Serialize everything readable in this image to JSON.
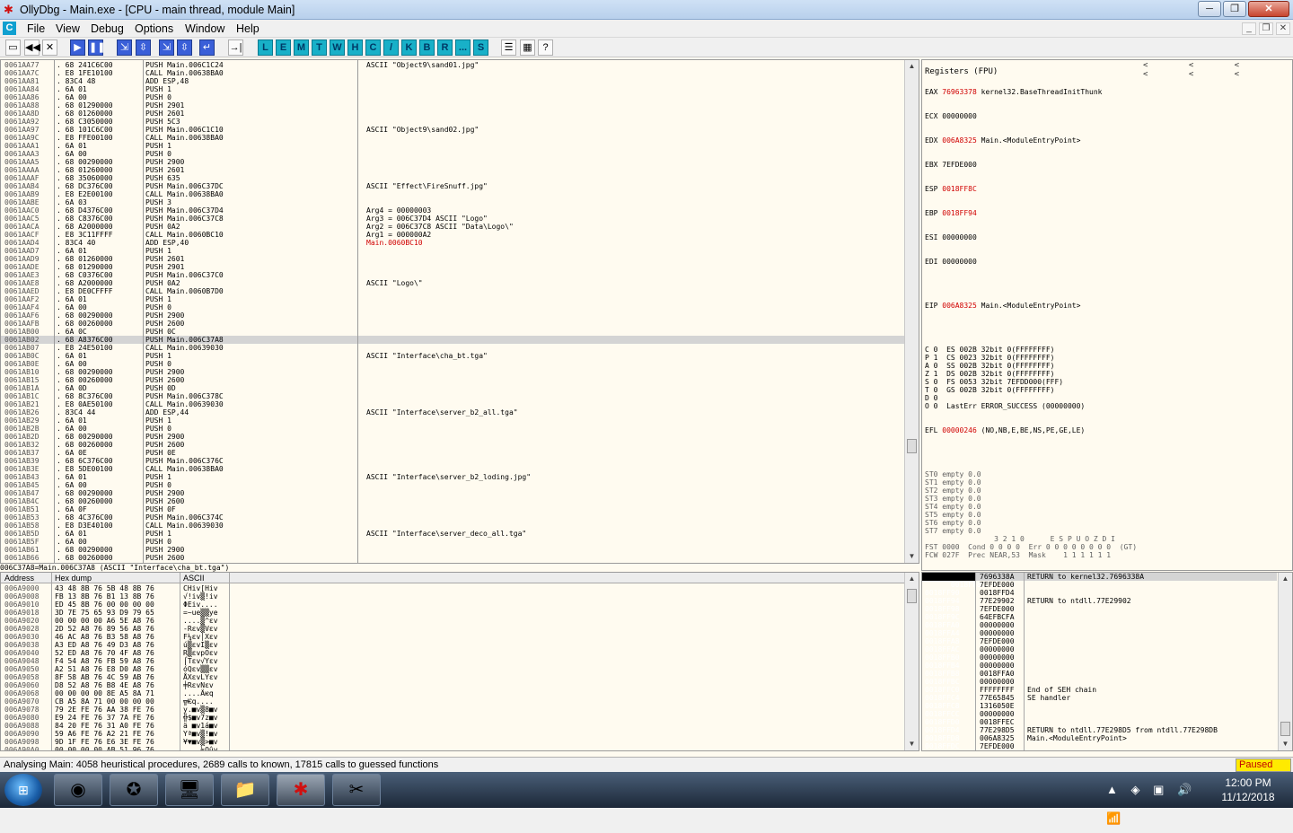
{
  "window": {
    "title": "OllyDbg - Main.exe - [CPU - main thread, module Main]",
    "min": "─",
    "max": "❐",
    "close": "✕"
  },
  "menu": {
    "mdi_icon": "C",
    "items": [
      "File",
      "View",
      "Debug",
      "Options",
      "Window",
      "Help"
    ],
    "mdi_min": "_",
    "mdi_max": "❐",
    "mdi_close": "✕"
  },
  "toolbar": {
    "buttons": [
      "open-icon",
      "rewind-icon",
      "close-icon",
      "run-icon",
      "pause-icon",
      "step-into-icon",
      "step-over-icon",
      "trace-into-icon",
      "trace-over-icon",
      "execute-till-return-icon",
      "go-to-icon"
    ],
    "glyphs": [
      "▭",
      "◀◀",
      "✕",
      "▶",
      "❚❚",
      "⇲",
      "⇳",
      "⇲",
      "⇳",
      "↵",
      "→|"
    ],
    "letters": [
      "L",
      "E",
      "M",
      "T",
      "W",
      "H",
      "C",
      "/",
      "K",
      "B",
      "R",
      "...",
      "S"
    ],
    "tail": [
      "☰",
      "▦",
      "?"
    ]
  },
  "disasm": {
    "addresses": "0061AA77\n0061AA7C\n0061AA81\n0061AA84\n0061AA86\n0061AA88\n0061AA8D\n0061AA92\n0061AA97\n0061AA9C\n0061AAA1\n0061AAA3\n0061AAA5\n0061AAAA\n0061AAAF\n0061AAB4\n0061AAB9\n0061AABE\n0061AAC0\n0061AAC5\n0061AACA\n0061AACF\n0061AAD4\n0061AAD7\n0061AAD9\n0061AADE\n0061AAE3\n0061AAE8\n0061AAED\n0061AAF2\n0061AAF4\n0061AAF6\n0061AAFB\n0061AB00\n0061AB02\n0061AB07\n0061AB0C\n0061AB0E\n0061AB10\n0061AB15\n0061AB1A\n0061AB1C\n0061AB21\n0061AB26\n0061AB29\n0061AB2B\n0061AB2D\n0061AB32\n0061AB37\n0061AB39\n0061AB3E\n0061AB43\n0061AB45\n0061AB47\n0061AB4C\n0061AB51\n0061AB53\n0061AB58\n0061AB5D\n0061AB5F\n0061AB61\n0061AB66",
    "hex": ". 68 241C6C00\n. E8 1FE10100\n. 83C4 48\n. 6A 01\n. 6A 00\n. 68 01290000\n. 68 01260000\n. 68 C3050000\n. 68 101C6C00\n. E8 FFE00100\n. 6A 01\n. 6A 00\n. 68 00290000\n. 68 01260000\n. 68 35060000\n. 68 DC376C00\n. E8 E2E00100\n. 6A 03\n. 68 D4376C00\n. 68 C8376C00\n. 68 A2000000\n. E8 3C11FFFF\n. 83C4 40\n. 6A 01\n. 68 01260000\n. 68 01290000\n. 68 C0376C00\n. 68 A2000000\n. E8 DE0CFFFF\n. 6A 01\n. 6A 00\n. 68 00290000\n. 68 00260000\n. 6A 0C\n. 68 A8376C00\n. E8 24E50100\n. 6A 01\n. 6A 00\n. 68 00290000\n. 68 00260000\n. 6A 0D\n. 68 8C376C00\n. E8 0AE50100\n. 83C4 44\n. 6A 01\n. 6A 00\n. 68 00290000\n. 68 00260000\n. 6A 0E\n. 68 6C376C00\n. E8 5DE00100\n. 6A 01\n. 6A 00\n. 68 00290000\n. 68 00260000\n. 6A 0F\n. 68 4C376C00\n. E8 D3E40100\n. 6A 01\n. 6A 00\n. 68 00290000\n. 68 00260000",
    "instr": "PUSH Main.006C1C24\nCALL Main.00638BA0\nADD ESP,48\nPUSH 1\nPUSH 0\nPUSH 2901\nPUSH 2601\nPUSH 5C3\nPUSH Main.006C1C10\nCALL Main.00638BA0\nPUSH 1\nPUSH 0\nPUSH 2900\nPUSH 2601\nPUSH 635\nPUSH Main.006C37DC\nCALL Main.00638BA0\nPUSH 3\nPUSH Main.006C37D4\nPUSH Main.006C37C8\nPUSH 0A2\nCALL Main.0060BC10\nADD ESP,40\nPUSH 1\nPUSH 2601\nPUSH 2901\nPUSH Main.006C37C0\nPUSH 0A2\nCALL Main.0060B7D0\nPUSH 1\nPUSH 0\nPUSH 2900\nPUSH 2600\nPUSH 0C\nPUSH Main.006C37A8\nCALL Main.00639030\nPUSH 1\nPUSH 0\nPUSH 2900\nPUSH 2600\nPUSH 0D\nPUSH Main.006C378C\nCALL Main.00639030\nADD ESP,44\nPUSH 1\nPUSH 0\nPUSH 2900\nPUSH 2600\nPUSH 0E\nPUSH Main.006C376C\nCALL Main.00638BA0\nPUSH 1\nPUSH 0\nPUSH 2900\nPUSH 2600\nPUSH 0F\nPUSH Main.006C374C\nCALL Main.00639030\nPUSH 1\nPUSH 0\nPUSH 2900\nPUSH 2600",
    "comments": "ASCII \"Object9\\sand01.jpg\"\n\n\n\n\n\n\n\nASCII \"Object9\\sand02.jpg\"\n\n\n\n\n\n\nASCII \"Effect\\FireSnuff.jpg\"\n\n\nArg4 = 00000003\nArg3 = 006C37D4 ASCII \"Logo\"\nArg2 = 006C37C8 ASCII \"Data\\Logo\\\"\nArg1 = 000000A2\nMain.0060BC10\n\n\n\n\nASCII \"Logo\\\"\n\n\n\n\n\n\n\n\nASCII \"Interface\\cha_bt.tga\"\n\n\n\n\n\n\nASCII \"Interface\\server_b2_all.tga\"\n\n\n\n\n\n\n\nASCII \"Interface\\server_b2_loding.jpg\"\n\n\n\n\n\n\nASCII \"Interface\\server_deco_all.tga\"",
    "info": "006C37A8=Main.006C37A8 (ASCII \"Interface\\cha_bt.tga\")"
  },
  "registers": {
    "title": "Registers (FPU)",
    "arrows": "< < < < < <",
    "regs": [
      {
        "name": "EAX",
        "value": "76963378",
        "comment": "kernel32.BaseThreadInitThunk"
      },
      {
        "name": "ECX",
        "value": "00000000",
        "comment": ""
      },
      {
        "name": "EDX",
        "value": "006A8325",
        "comment": "Main.<ModuleEntryPoint>"
      },
      {
        "name": "EBX",
        "value": "7EFDE000",
        "comment": ""
      },
      {
        "name": "ESP",
        "value": "0018FF8C",
        "comment": ""
      },
      {
        "name": "EBP",
        "value": "0018FF94",
        "comment": ""
      },
      {
        "name": "ESI",
        "value": "00000000",
        "comment": ""
      },
      {
        "name": "EDI",
        "value": "00000000",
        "comment": ""
      }
    ],
    "eip": {
      "name": "EIP",
      "value": "006A8325",
      "comment": "Main.<ModuleEntryPoint>"
    },
    "flags": "C 0  ES 002B 32bit 0(FFFFFFFF)\nP 1  CS 0023 32bit 0(FFFFFFFF)\nA 0  SS 002B 32bit 0(FFFFFFFF)\nZ 1  DS 002B 32bit 0(FFFFFFFF)\nS 0  FS 0053 32bit 7EFDD000(FFF)\nT 0  GS 002B 32bit 0(FFFFFFFF)\nD 0\nO 0  LastErr ERROR_SUCCESS (00000000)",
    "efl": {
      "label": "EFL",
      "value": "00000246",
      "comment": "(NO,NB,E,BE,NS,PE,GE,LE)"
    },
    "fpu": "ST0 empty 0.0\nST1 empty 0.0\nST2 empty 0.0\nST3 empty 0.0\nST4 empty 0.0\nST5 empty 0.0\nST6 empty 0.0\nST7 empty 0.0\n                3 2 1 0      E S P U O Z D I\nFST 0000  Cond 0 0 0 0  Err 0 0 0 0 0 0 0 0  (GT)\nFCW 027F  Prec NEAR,53  Mask    1 1 1 1 1 1"
  },
  "dump": {
    "col_address": "Address",
    "col_hex": "Hex dump",
    "col_ascii": "ASCII",
    "addresses": "006A9000\n006A9008\n006A9010\n006A9018\n006A9020\n006A9028\n006A9030\n006A9038\n006A9040\n006A9048\n006A9050\n006A9058\n006A9060\n006A9068\n006A9070\n006A9078\n006A9080\n006A9088\n006A9090\n006A9098\n006A90A0",
    "hex": "43 48 8B 76 5B 48 8B 76\nFB 13 8B 76 B1 13 8B 76\nED 45 8B 76 00 00 00 00\n3D 7E 75 65 93 D9 79 65\n00 00 00 00 A6 5E A8 76\n2D 52 A8 76 89 56 A8 76\n46 AC A8 76 B3 58 A8 76\nA3 ED A8 76 49 D3 A8 76\n52 ED A8 76 70 4F A8 76\nF4 54 A8 76 FB 59 A8 76\nA2 51 A8 76 E8 D0 A8 76\n8F 58 AB 76 4C 59 AB 76\nD8 52 A8 76 B8 4E A8 76\n00 00 00 00 8E A5 8A 71\nCB A5 8A 71 00 00 00 00\n79 2E FE 76 AA 38 FE 76\nE9 24 FE 76 37 7A FE 76\n84 20 FE 76 31 A0 FE 76\n59 A6 FE 76 A2 21 FE 76\n9D 1F FE 76 E6 3E FE 76\n00 00 00 00 AB 51 96 76",
    "ascii": "CHiv[Hiv\n√!iv▒!iv\nΦEiv....\n=~ue▒▒ye\n....▒^εv\n-Rεv▒Vεv\nF¼εv│Xεv\nú▒εvI▒εv\nR▒εvpOεv\n⌠Tεv√Yεv\nóQεv▒▒εv\nÅXεvLYεv\n╪RεvNεv\n....Äѥq\n╦Ѥq....\ny.■v▒8■v\n╬$■v7z■v\nä ■v1á■v\nYª■v▒!■v\n¥▼■v▒>■v\n....½Qûv"
  },
  "stack": {
    "addresses": "0018FF8C\n0018FF90\n0018FF94\n0018FF98\n0018FF9C\n0018FFA0\n0018FFA4\n0018FFA8\n0018FFAC\n0018FFB0\n0018FFB4\n0018FFB8\n0018FFBC\n0018FFC0\n0018FFC4\n0018FFC8\n0018FFCC\n0018FFD0\n0018FFD4\n0018FFD8\n0018FFDC\n0018FFE0",
    "values": "7696338A\n7EFDE000\n0018FFD4\n77E29902\n7EFDE000\n64EFBCFA\n00000000\n00000000\n7EFDE000\n00000000\n00000000\n00000000\n0018FFA0\n00000000\nFFFFFFFF\n77E65845\n1316050E\n00000000\n0018FFEC\n77E298D5\n006A8325\n7EFDE000",
    "comments": "RETURN to kernel32.7696338A\n\n\nRETURN to ntdll.77E29902\n\n\n\n\n\n\n\n\n\n\nEnd of SEH chain\nSE handler\n\n\n\nRETURN to ntdll.77E298D5 from ntdll.77E298DB\nMain.<ModuleEntryPoint>\n"
  },
  "status": {
    "text": "Analysing Main: 4058 heuristical procedures, 2689 calls to known, 17815 calls to guessed functions",
    "state": "Paused"
  },
  "taskbar": {
    "start": "⊞",
    "apps": [
      "chrome-icon",
      "bandicam-icon",
      "remote-desktop-icon",
      "explorer-folder-icon",
      "ollydbg-icon",
      "tools-icon"
    ],
    "glyphs": [
      "◉",
      "✪",
      "🖥",
      "📁",
      "✱",
      "✂"
    ],
    "tray": [
      "▲",
      "◈",
      "▣",
      "🔊",
      "📶"
    ],
    "time": "12:00 PM",
    "date": "11/12/2018"
  }
}
